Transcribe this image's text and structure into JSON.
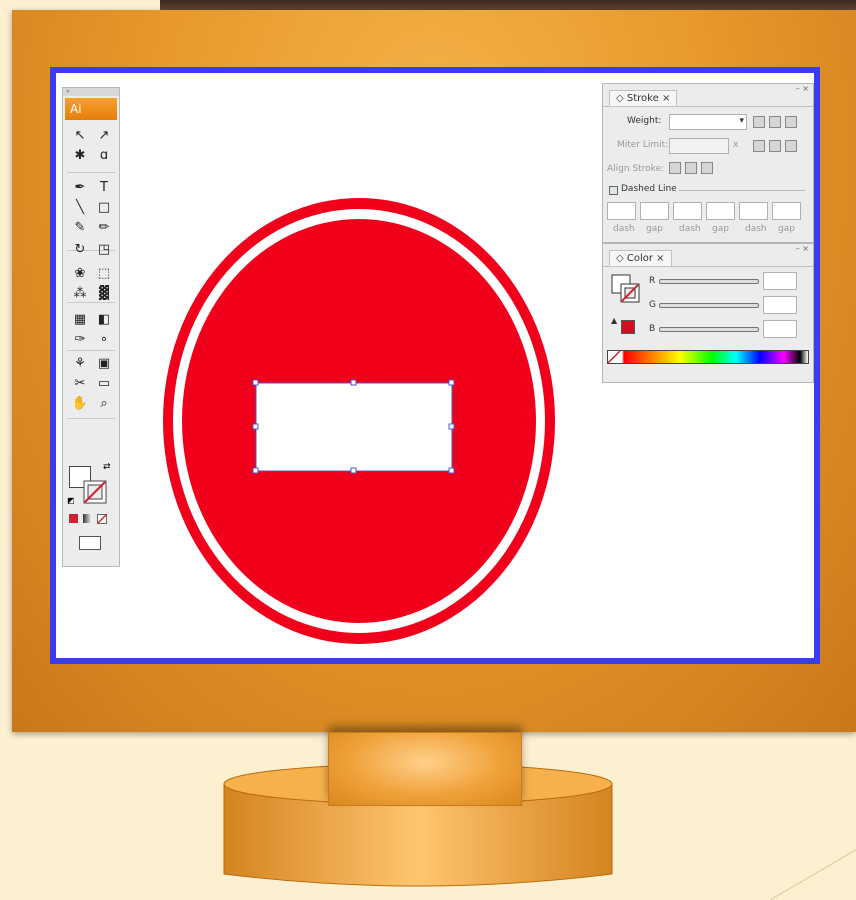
{
  "app": {
    "logo_text": "Ai"
  },
  "toolbox": {
    "grip": "»",
    "tools": [
      {
        "name": "selection-tool",
        "glyph": "↖"
      },
      {
        "name": "direct-selection-tool",
        "glyph": "↗"
      },
      {
        "name": "magic-wand-tool",
        "glyph": "✱"
      },
      {
        "name": "lasso-tool",
        "glyph": "ɑ"
      },
      {
        "name": "pen-tool",
        "glyph": "✒"
      },
      {
        "name": "type-tool",
        "glyph": "T"
      },
      {
        "name": "line-segment-tool",
        "glyph": "╲"
      },
      {
        "name": "rectangle-tool",
        "glyph": "□"
      },
      {
        "name": "paintbrush-tool",
        "glyph": "✎"
      },
      {
        "name": "pencil-tool",
        "glyph": "✏"
      },
      {
        "name": "rotate-tool",
        "glyph": "↻"
      },
      {
        "name": "scale-tool",
        "glyph": "◳"
      },
      {
        "name": "warp-tool",
        "glyph": "❀"
      },
      {
        "name": "free-transform-tool",
        "glyph": "⬚"
      },
      {
        "name": "symbol-sprayer-tool",
        "glyph": "⁂"
      },
      {
        "name": "column-graph-tool",
        "glyph": "▓"
      },
      {
        "name": "mesh-tool",
        "glyph": "▦"
      },
      {
        "name": "gradient-tool",
        "glyph": "◧"
      },
      {
        "name": "eyedropper-tool",
        "glyph": "✑"
      },
      {
        "name": "blend-tool",
        "glyph": "∘"
      },
      {
        "name": "live-paint-bucket-tool",
        "glyph": "⚘"
      },
      {
        "name": "live-paint-selection-tool",
        "glyph": "▣"
      },
      {
        "name": "slice-tool",
        "glyph": "✂"
      },
      {
        "name": "eraser-tool",
        "glyph": "▭"
      },
      {
        "name": "hand-tool",
        "glyph": "✋"
      },
      {
        "name": "zoom-tool",
        "glyph": "⌕"
      }
    ],
    "fill_color": "#ffffff",
    "stroke_color": "none",
    "mode_color": "#d22030"
  },
  "stroke_panel": {
    "tab_label": "Stroke",
    "close_glyph": "×",
    "weight_label": "Weight:",
    "weight_value": "",
    "miter_label": "Miter Limit:",
    "miter_value": "",
    "miter_suffix": "x",
    "align_label": "Align Stroke:",
    "dashed_label": "Dashed Line",
    "dash_labels": [
      "dash",
      "gap",
      "dash",
      "gap",
      "dash",
      "gap"
    ]
  },
  "color_panel": {
    "tab_label": "Color",
    "close_glyph": "×",
    "channels": [
      {
        "label": "R",
        "value": ""
      },
      {
        "label": "G",
        "value": ""
      },
      {
        "label": "B",
        "value": ""
      }
    ],
    "current_color": "#d01020"
  },
  "artwork": {
    "sign_color": "#f0001a",
    "ring_color": "#ffffff",
    "bar_color": "#ffffff",
    "selection_color": "#4a58d0"
  }
}
